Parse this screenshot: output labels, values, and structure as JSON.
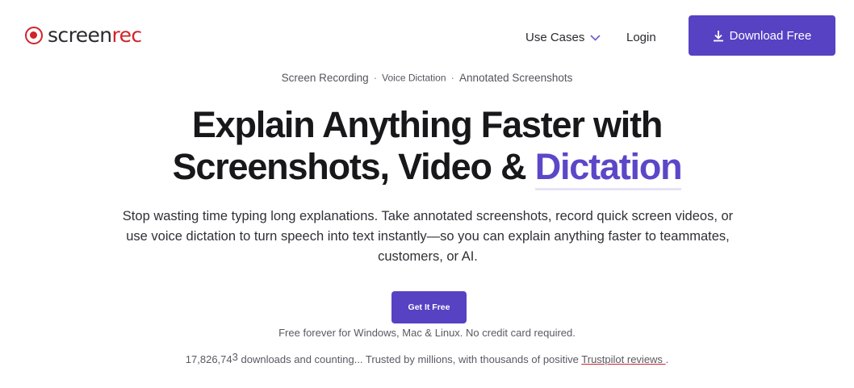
{
  "brand": {
    "name_part1": "screen",
    "name_part2": "rec",
    "logo_color": "#d1232a"
  },
  "nav": {
    "use_cases": "Use Cases",
    "login": "Login",
    "download_button": "Download Free"
  },
  "tags": {
    "item1": "Screen Recording",
    "item2": "Voice Dictation",
    "item3": "Annotated Screenshots",
    "separator": "·"
  },
  "hero": {
    "title_line1": "Explain Anything Faster with",
    "title_line2_prefix": "Screenshots, Video & ",
    "title_line2_accent": "Dictation",
    "subtitle": "Stop wasting time typing long explanations. Take annotated screenshots, record quick screen videos, or use voice dictation to turn speech into text instantly—so you can explain anything faster to teammates, customers, or AI.",
    "cta_button": "Get It Free",
    "note": "Free forever for Windows, Mac & Linux. No credit card required."
  },
  "stats": {
    "count_main": "17,826,74",
    "count_last": "3",
    "text": " downloads and counting... Trusted by millions, with thousands of positive ",
    "link": "Trustpilot reviews ",
    "suffix": "."
  },
  "colors": {
    "accent": "#5642c2",
    "accent_text": "#5b47c8",
    "brand_red": "#d1232a"
  },
  "icons": {
    "download": "download-icon",
    "chevron": "chevron-down-icon"
  }
}
